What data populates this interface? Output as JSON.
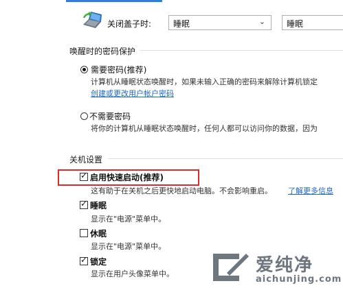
{
  "lid_close": {
    "label": "关闭盖子时:",
    "battery_value": "睡眠",
    "plugged_value": "睡眠"
  },
  "wake_password": {
    "section_title": "唤醒时的密码保护",
    "require": {
      "label": "需要密码(推荐)",
      "desc": "计算机从睡眠状态唤醒时，如果未输入正确的密码来解除计算机锁定",
      "link": "创建或更改用户帐户密码",
      "selected": true
    },
    "no_require": {
      "label": "不需要密码",
      "desc": "将你的计算机从睡眠状态唤醒时，任何人都可以访问你的数据，因为",
      "selected": false
    }
  },
  "shutdown": {
    "section_title": "关机设置",
    "fast_startup": {
      "label": "启用快速启动(推荐)",
      "desc": "这有助于在关机之后更快地启动电脑。不会影响重启。",
      "link": "了解更多信息",
      "checked": true
    },
    "sleep": {
      "label": "睡眠",
      "desc": "显示在\"电源\"菜单中。",
      "checked": true
    },
    "hibernate": {
      "label": "休眠",
      "desc": "显示在\"电源\"菜单中。",
      "checked": false
    },
    "lock": {
      "label": "锁定",
      "desc": "显示在用户头像菜单中。",
      "checked": true
    }
  },
  "watermark": {
    "name": "爱纯净",
    "url": "aichunjing.com"
  },
  "colors": {
    "highlight_box": "#e02a2a",
    "link": "#1e66c4",
    "accent_line": "#2f7fd6"
  }
}
